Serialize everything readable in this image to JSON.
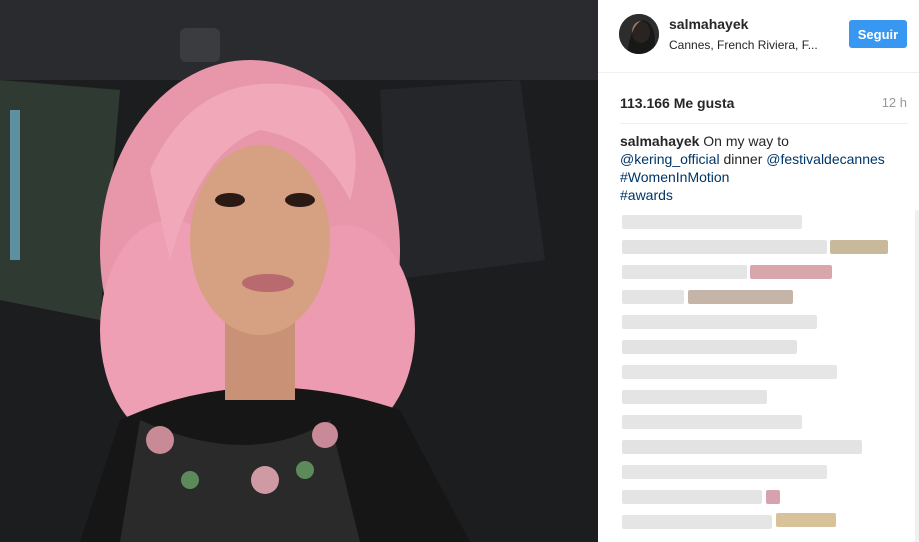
{
  "post": {
    "username": "salmahayek",
    "location": "Cannes, French Riviera, F...",
    "follow_label": "Seguir",
    "likes": "113.166 Me gusta",
    "time": "12 h",
    "caption": {
      "user": "salmahayek",
      "text1": " On my way to ",
      "mention1": "@kering_official",
      "text2": " dinner ",
      "mention2": "@festivaldecannes",
      "space": " ",
      "tag1": "#WomenInMotion",
      "tag2": "#awards"
    }
  },
  "colors": {
    "follow": "#3897f0",
    "link": "#003569",
    "hair": "#f2a3b4"
  }
}
